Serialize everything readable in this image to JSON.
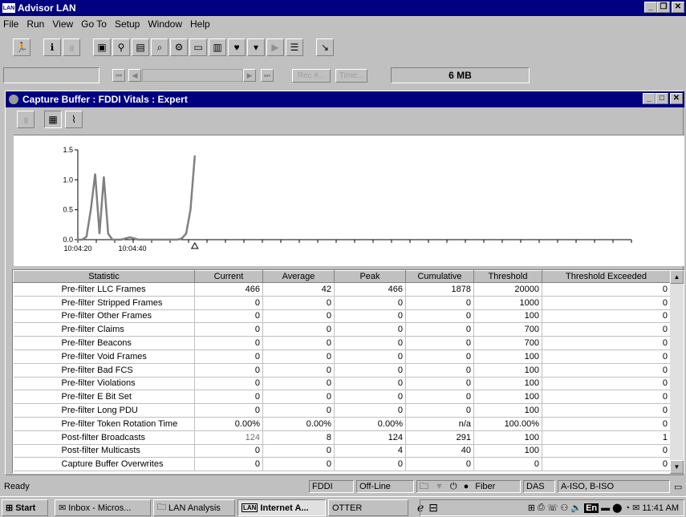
{
  "app": {
    "title": "Advisor LAN",
    "icon_text": "LAN"
  },
  "menu": [
    "File",
    "Run",
    "View",
    "Go To",
    "Setup",
    "Window",
    "Help"
  ],
  "toolbar": {
    "icons": [
      "run-figure-icon",
      "info-icon",
      "pause-icon",
      "capture-icon",
      "filter-icon",
      "stats-icon",
      "search-icon",
      "setup-icon",
      "monitor-icon",
      "chart-icon",
      "heart-icon",
      "dropdown-icon",
      "play-icon",
      "list-icon",
      "connect-icon"
    ]
  },
  "nav": {
    "rec_label": "Rec #...",
    "time_label": "Time...",
    "buffer_size": "6 MB"
  },
  "child": {
    "title": "Capture Buffer : FDDI Vitals : Expert",
    "view_icons": [
      "pause-icon",
      "table-view-icon",
      "graph-view-icon"
    ]
  },
  "chart_data": {
    "type": "line",
    "ylim": [
      0,
      1.5
    ],
    "yticks": [
      "0.0",
      "0.5",
      "1.0",
      "1.5"
    ],
    "xticks": [
      "10:04:20",
      "10:04:40"
    ],
    "color": "#808080",
    "series": [
      {
        "x": [
          0,
          1,
          2,
          3,
          4,
          5,
          6,
          7,
          8,
          9,
          10,
          11,
          12,
          13,
          14,
          15,
          16,
          17,
          18,
          19,
          20,
          21,
          22,
          23,
          24,
          25,
          26,
          27
        ],
        "values": [
          0.0,
          0.0,
          0.05,
          0.5,
          1.1,
          0.1,
          1.05,
          0.1,
          0.0,
          0.0,
          0.0,
          0.02,
          0.04,
          0.02,
          0.0,
          0.0,
          0.0,
          0.0,
          0.0,
          0.0,
          0.0,
          0.0,
          0.0,
          0.0,
          0.02,
          0.1,
          0.5,
          1.4
        ]
      }
    ]
  },
  "table": {
    "columns": [
      "Statistic",
      "Current",
      "Average",
      "Peak",
      "Cumulative",
      "Threshold",
      "Threshold Exceeded"
    ],
    "rows": [
      [
        "Pre-filter LLC Frames",
        "466",
        "42",
        "466",
        "1878",
        "20000",
        "0"
      ],
      [
        "Pre-filter Stripped Frames",
        "0",
        "0",
        "0",
        "0",
        "1000",
        "0"
      ],
      [
        "Pre-filter Other Frames",
        "0",
        "0",
        "0",
        "0",
        "100",
        "0"
      ],
      [
        "Pre-filter Claims",
        "0",
        "0",
        "0",
        "0",
        "700",
        "0"
      ],
      [
        "Pre-filter Beacons",
        "0",
        "0",
        "0",
        "0",
        "700",
        "0"
      ],
      [
        "Pre-filter Void Frames",
        "0",
        "0",
        "0",
        "0",
        "100",
        "0"
      ],
      [
        "Pre-filter Bad FCS",
        "0",
        "0",
        "0",
        "0",
        "100",
        "0"
      ],
      [
        "Pre-filter Violations",
        "0",
        "0",
        "0",
        "0",
        "100",
        "0"
      ],
      [
        "Pre-filter E Bit Set",
        "0",
        "0",
        "0",
        "0",
        "100",
        "0"
      ],
      [
        "Pre-filter Long PDU",
        "0",
        "0",
        "0",
        "0",
        "100",
        "0"
      ],
      [
        "Pre-filter Token Rotation Time",
        "0.00%",
        "0.00%",
        "0.00%",
        "n/a",
        "100.00%",
        "0"
      ],
      [
        "Post-filter Broadcasts",
        "124",
        "8",
        "124",
        "291",
        "100",
        "1"
      ],
      [
        "Post-filter Multicasts",
        "0",
        "0",
        "4",
        "40",
        "100",
        "0"
      ],
      [
        "Capture Buffer Overwrites",
        "0",
        "0",
        "0",
        "0",
        "0",
        "0"
      ]
    ]
  },
  "status": {
    "ready": "Ready",
    "panels": [
      "FDDI",
      "Off-Line",
      "Fiber",
      "DAS",
      "A-ISO, B-ISO"
    ]
  },
  "taskbar": {
    "start": "Start",
    "buttons": [
      "Inbox - Micros...",
      "LAN Analysis",
      "Internet A...",
      "OTTER"
    ],
    "clock": "11:41 AM",
    "lang": "En"
  }
}
